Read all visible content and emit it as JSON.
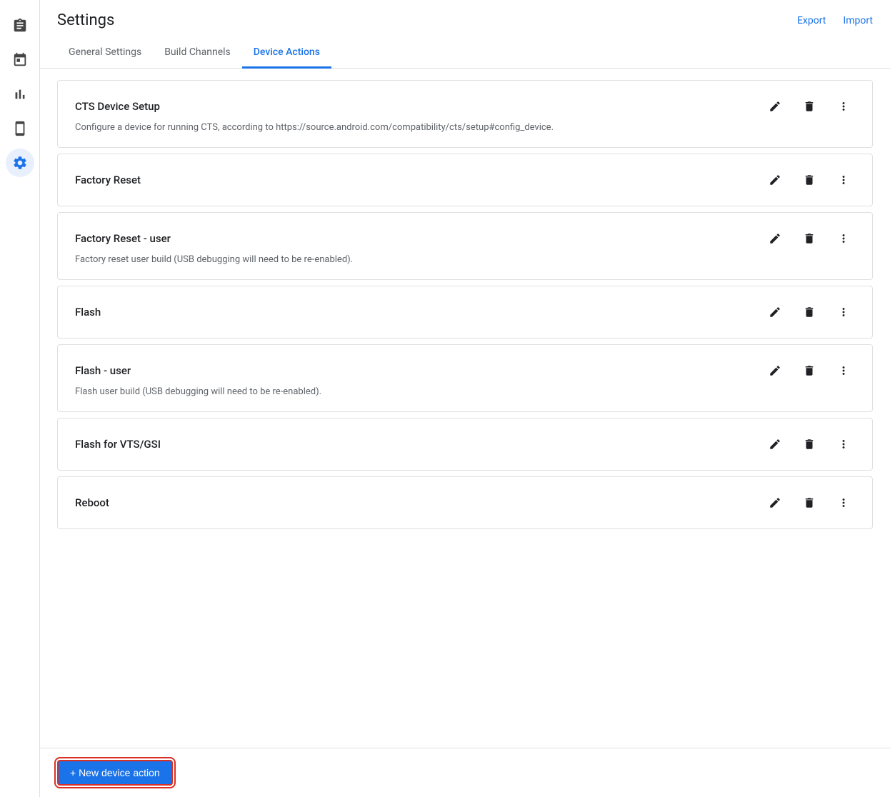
{
  "page": {
    "title": "Settings",
    "header_links": [
      {
        "label": "Export",
        "key": "export"
      },
      {
        "label": "Import",
        "key": "import"
      }
    ]
  },
  "tabs": [
    {
      "label": "General Settings",
      "key": "general",
      "active": false
    },
    {
      "label": "Build Channels",
      "key": "build-channels",
      "active": false
    },
    {
      "label": "Device Actions",
      "key": "device-actions",
      "active": true
    }
  ],
  "sidebar": {
    "items": [
      {
        "icon": "clipboard-icon",
        "label": "Clipboard"
      },
      {
        "icon": "calendar-icon",
        "label": "Calendar"
      },
      {
        "icon": "chart-icon",
        "label": "Chart"
      },
      {
        "icon": "device-icon",
        "label": "Device"
      },
      {
        "icon": "settings-icon",
        "label": "Settings",
        "active": true
      }
    ]
  },
  "device_actions": [
    {
      "title": "CTS Device Setup",
      "description": "Configure a device for running CTS, according to https://source.android.com/compatibility/cts/setup#config_device."
    },
    {
      "title": "Factory Reset",
      "description": ""
    },
    {
      "title": "Factory Reset - user",
      "description": "Factory reset user build (USB debugging will need to be re-enabled)."
    },
    {
      "title": "Flash",
      "description": ""
    },
    {
      "title": "Flash - user",
      "description": "Flash user build (USB debugging will need to be re-enabled)."
    },
    {
      "title": "Flash for VTS/GSI",
      "description": ""
    },
    {
      "title": "Reboot",
      "description": ""
    }
  ],
  "bottom": {
    "new_action_label": "+ New device action"
  }
}
